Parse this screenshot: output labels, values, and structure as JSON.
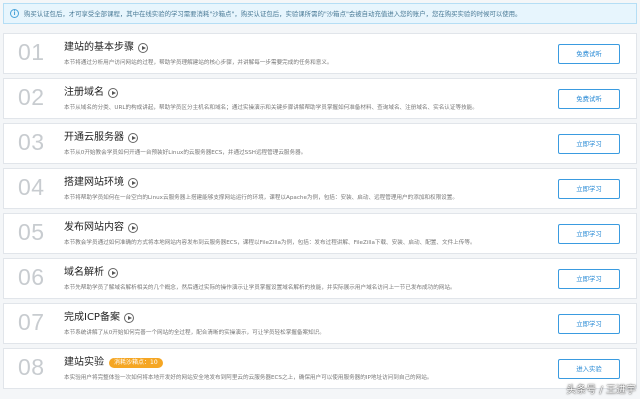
{
  "notice": {
    "icon": "info-icon",
    "text": "购买认证包后，才可享受全部课程，其中在线实验的学习需要消耗\"沙箱点\"，购买认证包后，实验课所需的\"沙箱点\"会被自动充值进入您的账户，您在购买实验的时候可以使用。"
  },
  "lessons": [
    {
      "num": "01",
      "title": "建站的基本步骤",
      "desc": "本节将通过分析用户访问网站的过程，帮助学员理解建站的核心步骤，并讲解每一步需要完成的任务和意义。",
      "button": "免费试听"
    },
    {
      "num": "02",
      "title": "注册域名",
      "desc": "本节从域名的分类、URL的构成讲起，帮助学员区分主机名和域名；通过实操演示和关键步骤讲解帮助学员掌握如何准备材料、查询域名、注册域名、实名认证等技能。",
      "button": "免费试听"
    },
    {
      "num": "03",
      "title": "开通云服务器",
      "desc": "本节从0开始教会学员如何开通一台预装好Linux的云服务器ECS，并通过SSH远程管理云服务器。",
      "button": "立即学习"
    },
    {
      "num": "04",
      "title": "搭建网站环境",
      "desc": "本节将帮助学员如何在一台空白的Linux云服务器上搭建能够支撑网站运行的环境，课程以Apache为例，包括：安装、启动、远程管理用户的添加和权限设置。",
      "button": "立即学习"
    },
    {
      "num": "05",
      "title": "发布网站内容",
      "desc": "本节教会学员通过如何准确的方式将本地网站内容发布到云服务器ECS，课程以FileZilla为例，包括：发布过程讲解、FileZilla下载、安装、启动、配置、文件上传等。",
      "button": "立即学习"
    },
    {
      "num": "06",
      "title": "域名解析",
      "desc": "本节先帮助学员了解域名解析相关的几个概念，然后通过实际的操作演示让学员掌握设置域名解析的技能，并实际展示用户域名访问上一节已发布成功的网站。",
      "button": "立即学习"
    },
    {
      "num": "07",
      "title": "完成ICP备案",
      "desc": "本节系统讲解了从0开始如何完善一个网站的全过程，配合清晰的实操演示，可让学员轻松掌握备案知识。",
      "button": "立即学习"
    },
    {
      "num": "08",
      "title": "建站实验",
      "badge": "消耗沙箱点：10",
      "desc": "本实验用户将完整体验一次如何将本地开发好的网站安全地发布到阿里云的云服务器ECS之上，确保用户可以使用服务器的IP地址访问到自己的网站。",
      "button": "进入实验"
    }
  ],
  "watermark": "头条号 / 王进宇"
}
